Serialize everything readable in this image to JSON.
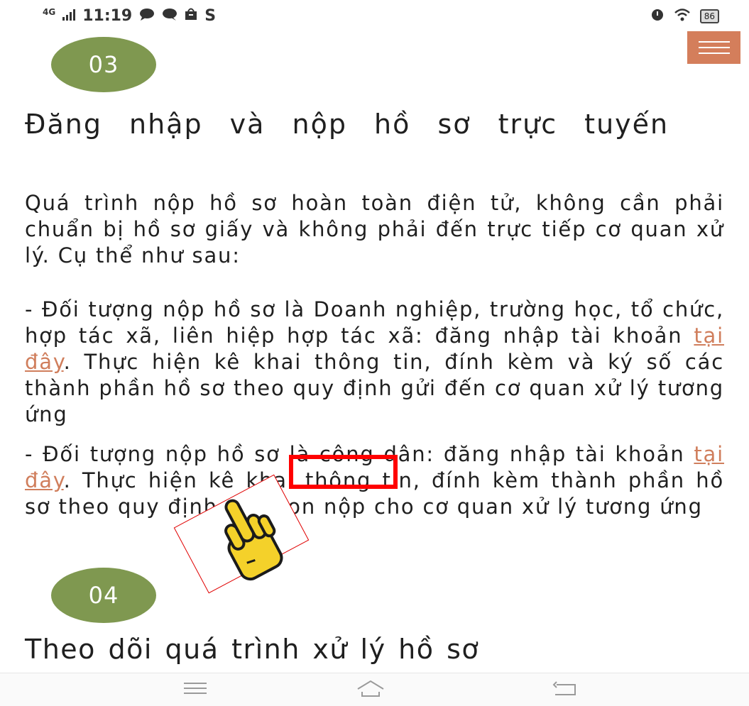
{
  "status_bar": {
    "network": "4G",
    "time": "11:19",
    "carrier_letter": "S",
    "battery": "86",
    "icons_left": [
      "signal-icon",
      "chat-bubble-icon",
      "message-icon",
      "shopping-bag-icon"
    ],
    "icons_right": [
      "alarm-icon",
      "wifi-icon",
      "battery-icon"
    ]
  },
  "section3": {
    "number": "03",
    "heading": "Đăng nhập và nộp hồ sơ trực tuyến",
    "para1": "Quá trình nộp hồ sơ hoàn toàn điện tử, không cần phải chuẩn bị hồ sơ giấy và không phải đến trực tiếp cơ quan xử lý. Cụ thể như sau:",
    "para2_before": "- Đối tượng nộp hồ sơ là Doanh nghiệp, trường học, tổ chức, hợp tác xã, liên hiệp hợp tác xã: đăng nhập tài khoản ",
    "para2_link": "tại đây",
    "para2_after": ". Thực hiện kê khai thông tin, đính kèm và ký số các thành phần hồ sơ theo quy định gửi đến cơ quan xử lý tương ứng",
    "para3_before": "- Đối tượng nộp hồ sơ là công dân: đăng nhập tài khoản ",
    "para3_link": "tại đây",
    "para3_after": ". Thực hiện kê khai thông tin, đính kèm thành phần hồ sơ theo quy định và chọn nộp cho cơ quan xử lý tương ứng"
  },
  "section4": {
    "number": "04",
    "heading": "Theo dõi quá trình xử lý hồ sơ"
  },
  "colors": {
    "badge": "#7f9850",
    "menu": "#d47e5b",
    "link": "#d07e5c",
    "highlight": "#ff0000"
  }
}
